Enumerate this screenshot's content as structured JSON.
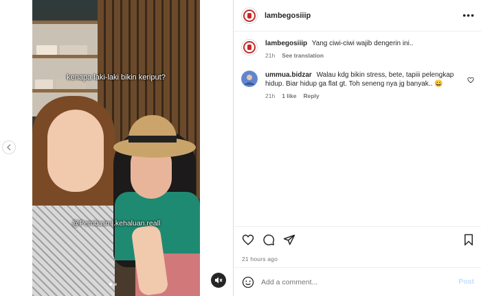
{
  "post": {
    "author": "lambegosiiip",
    "media": {
      "caption_overlay": "kenapa laki-laki bikin keriput?",
      "handle_overlay": "@Pembasmi.kehaluan.reall",
      "slide_count": 2,
      "active_slide": 1
    },
    "caption": {
      "username": "lambegosiiip",
      "text": "Yang ciwi-ciwi wajib dengerin ini..",
      "time": "21h",
      "see_translation": "See translation"
    },
    "comments": [
      {
        "username": "ummua.bidzar",
        "text": "Walau kdg bikin stress, bete, tapiii pelengkap hidup. Biar hidup ga flat gt. Toh seneng nya jg banyak.. 😀",
        "time": "21h",
        "likes": "1 like",
        "reply": "Reply"
      }
    ],
    "posted_ago": "21 hours ago"
  },
  "add_comment": {
    "placeholder": "Add a comment...",
    "post_label": "Post"
  },
  "header": {
    "more_label": "•••"
  },
  "colors": {
    "border": "#dbdbdb",
    "muted_text": "#737373",
    "post_button_disabled": "#c0dffd",
    "avatar_brand": "#c62828"
  },
  "icons": [
    "chevron-left-icon",
    "mute-icon",
    "heart-icon",
    "comment-icon",
    "share-icon",
    "bookmark-icon",
    "emoji-icon",
    "more-icon"
  ]
}
